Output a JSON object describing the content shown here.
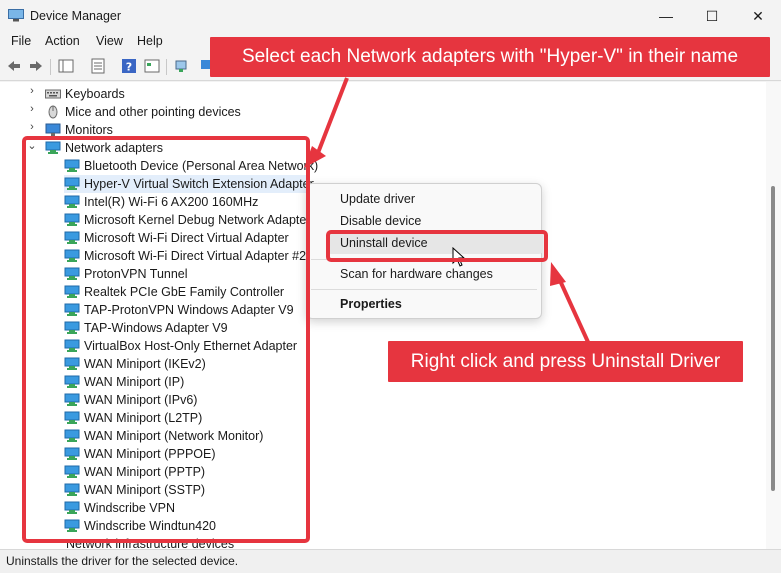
{
  "window": {
    "title": "Device Manager",
    "minimize": "—",
    "maximize": "☐",
    "close": "✕"
  },
  "menu": [
    "File",
    "Action",
    "View",
    "Help"
  ],
  "tree": {
    "keyboards": "Keyboards",
    "mice": "Mice and other pointing devices",
    "monitors": "Monitors",
    "network_adapters": "Network adapters",
    "adapters": [
      "Bluetooth Device (Personal Area Network)",
      "Hyper-V Virtual Switch Extension Adapter",
      "Intel(R) Wi-Fi 6 AX200 160MHz",
      "Microsoft Kernel Debug Network Adapter",
      "Microsoft Wi-Fi Direct Virtual Adapter",
      "Microsoft Wi-Fi Direct Virtual Adapter #2",
      "ProtonVPN Tunnel",
      "Realtek PCIe GbE Family Controller",
      "TAP-ProtonVPN Windows Adapter V9",
      "TAP-Windows Adapter V9",
      "VirtualBox Host-Only Ethernet Adapter",
      "WAN Miniport (IKEv2)",
      "WAN Miniport (IP)",
      "WAN Miniport (IPv6)",
      "WAN Miniport (L2TP)",
      "WAN Miniport (Network Monitor)",
      "WAN Miniport (PPPOE)",
      "WAN Miniport (PPTP)",
      "WAN Miniport (SSTP)",
      "Windscribe VPN",
      "Windscribe Windtun420"
    ],
    "selected_index": 1,
    "partial_bottom": "Network infrastructure devices"
  },
  "context_menu": {
    "update": "Update driver",
    "disable": "Disable device",
    "uninstall": "Uninstall device",
    "scan": "Scan for hardware changes",
    "properties": "Properties"
  },
  "status_text": "Uninstalls the driver for the selected device.",
  "callouts": {
    "top": "Select each Network adapters with \"Hyper-V\" in their name",
    "bottom": "Right click and press Uninstall Driver"
  },
  "colors": {
    "annotation_red": "#e6353f",
    "selection": "#e3eefb",
    "network_icon": "#2f8fd8"
  }
}
